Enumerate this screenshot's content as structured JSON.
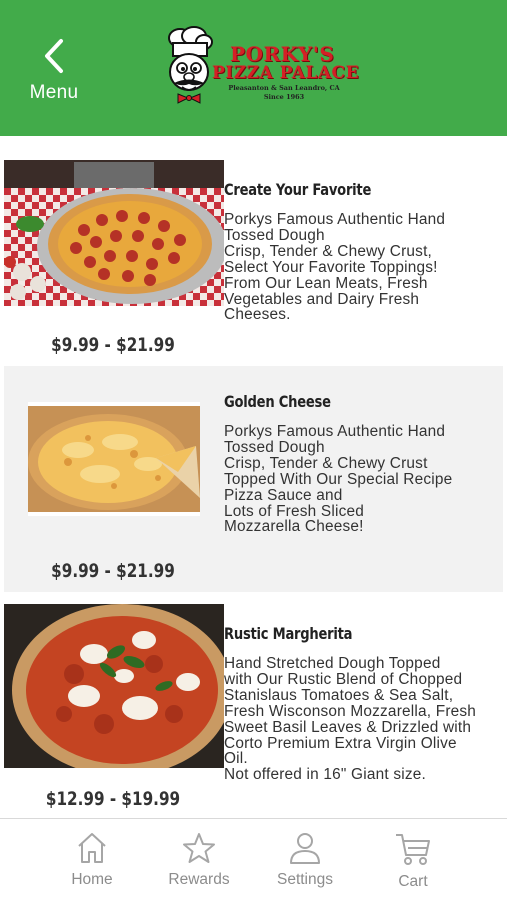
{
  "header": {
    "back_label": "Menu",
    "logo_line1": "PORKY'S",
    "logo_line2": "PIZZA PALACE",
    "logo_line3": "Pleasanton & San Leandro, CA",
    "logo_line4": "Since 1963",
    "bg_color": "#42ab4a"
  },
  "items": [
    {
      "title": "Create Your Favorite",
      "desc_lines": [
        "Porkys Famous Authentic Hand",
        "Tossed Dough",
        "Crisp, Tender & Chewy Crust,",
        "Select Your Favorite Toppings!",
        "From Our Lean Meats, Fresh",
        "Vegetables and Dairy Fresh",
        "Cheeses."
      ],
      "price": "$9.99 - $21.99",
      "image": "pepperoni-pizza"
    },
    {
      "title": "Golden Cheese",
      "desc_lines": [
        "Porkys Famous Authentic Hand",
        "Tossed Dough",
        "Crisp, Tender & Chewy Crust",
        "Topped With Our Special Recipe",
        "Pizza Sauce and",
        "Lots of Fresh Sliced",
        "Mozzarella Cheese!"
      ],
      "price": "$9.99 - $21.99",
      "image": "cheese-pizza"
    },
    {
      "title": "Rustic Margherita",
      "desc_lines": [
        "Hand Stretched Dough Topped",
        "with Our Rustic Blend of Chopped",
        "Stanislaus Tomatoes & Sea Salt,",
        "Fresh Wisconson Mozzarella, Fresh",
        "Sweet Basil Leaves & Drizzled with",
        "Corto Premium Extra Virgin Olive",
        "Oil.",
        "Not offered in 16\" Giant size."
      ],
      "price": "$12.99 - $19.99",
      "image": "margherita-pizza"
    }
  ],
  "tabs": [
    {
      "label": "Home",
      "icon": "home-icon"
    },
    {
      "label": "Rewards",
      "icon": "star-icon"
    },
    {
      "label": "Settings",
      "icon": "person-icon"
    },
    {
      "label": "Cart",
      "icon": "cart-icon"
    }
  ]
}
